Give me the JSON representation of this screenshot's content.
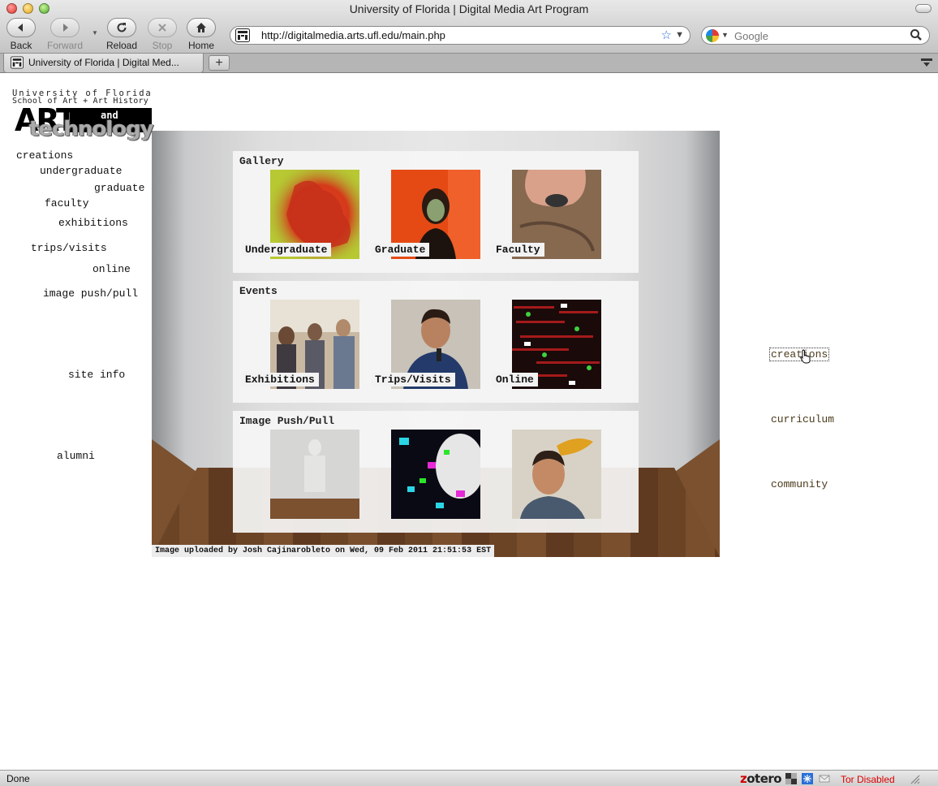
{
  "window": {
    "title": "University of Florida | Digital Media Art Program"
  },
  "toolbar": {
    "back": "Back",
    "forward": "Forward",
    "reload": "Reload",
    "stop": "Stop",
    "home": "Home",
    "url": "http://digitalmedia.arts.ufl.edu/main.php",
    "search_placeholder": "Google"
  },
  "tabs": [
    {
      "label": "University of Florida | Digital Med..."
    }
  ],
  "logo": {
    "line1": "University of Florida",
    "line2": "School of Art + Art History",
    "art": "ART",
    "and": "and",
    "technology": "technology"
  },
  "left_nav": {
    "creations": "creations",
    "undergraduate": "undergraduate",
    "graduate": "graduate",
    "faculty": "faculty",
    "exhibitions": "exhibitions",
    "trips_visits": "trips/visits",
    "online": "online",
    "image_push_pull": "image push/pull",
    "site_info": "site info",
    "alumni": "alumni"
  },
  "right_nav": {
    "creations": "creations",
    "curriculum": "curriculum",
    "community": "community"
  },
  "panels": {
    "gallery": {
      "title": "Gallery",
      "items": [
        "Undergraduate",
        "Graduate",
        "Faculty"
      ]
    },
    "events": {
      "title": "Events",
      "items": [
        "Exhibitions",
        "Trips/Visits",
        "Online"
      ]
    },
    "push_pull": {
      "title": "Image Push/Pull"
    }
  },
  "caption": "Image uploaded by Josh Cajinarobleto on Wed, 09 Feb 2011 21:51:53 EST",
  "statusbar": {
    "status": "Done",
    "zotero_z": "z",
    "zotero_rest": "otero",
    "tor": "Tor Disabled"
  },
  "colors": {
    "accent": "#2d6fd6",
    "tor": "#dd0000",
    "right_nav": "#4a3a1a"
  }
}
